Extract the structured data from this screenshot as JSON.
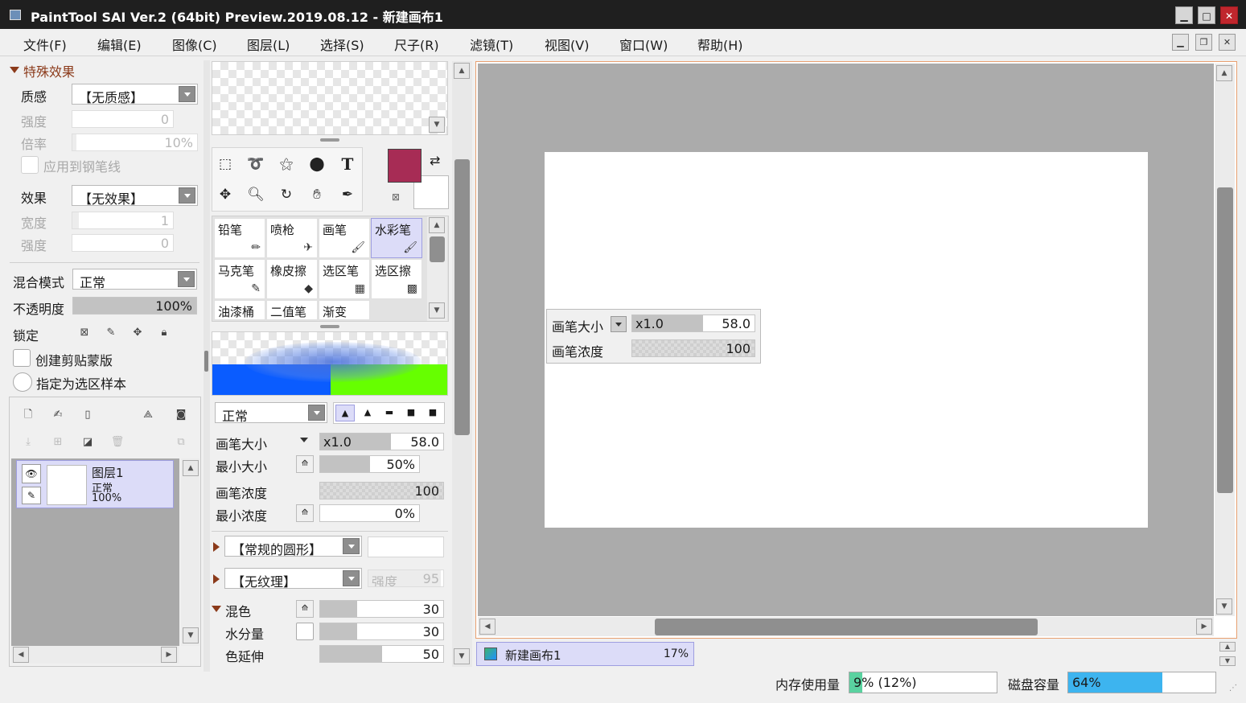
{
  "window": {
    "title": "PaintTool SAI Ver.2 (64bit) Preview.2019.08.12 - 新建画布1"
  },
  "menu": [
    "文件(F)",
    "编辑(E)",
    "图像(C)",
    "图层(L)",
    "选择(S)",
    "尺子(R)",
    "滤镜(T)",
    "视图(V)",
    "窗口(W)",
    "帮助(H)"
  ],
  "effects": {
    "section": "特殊效果",
    "texture_label": "质感",
    "texture_value": "【无质感】",
    "strength_label": "强度",
    "strength_value": "0",
    "rate_label": "倍率",
    "rate_value": "10%",
    "apply_pen_label": "应用到钢笔线",
    "effect_label": "效果",
    "effect_value": "【无效果】",
    "width_label": "宽度",
    "width_value": "1",
    "strength2_label": "强度",
    "strength2_value": "0"
  },
  "layerprops": {
    "blend_label": "混合模式",
    "blend_value": "正常",
    "opacity_label": "不透明度",
    "opacity_value": "100%",
    "opacity": 1.0,
    "lock_label": "锁定",
    "clip_label": "创建剪贴蒙版",
    "selsrc_label": "指定为选区样本"
  },
  "layers": [
    {
      "name": "图层1",
      "mode": "正常",
      "opacity": "100%"
    }
  ],
  "colors": {
    "primary": "#a72c55",
    "secondary": "#ffffff",
    "accent_blue": "#0a5cff",
    "accent_green": "#66ff00",
    "close_red": "#c0262d"
  },
  "brushes": [
    {
      "name": "铅笔",
      "icon": "pencil-icon"
    },
    {
      "name": "喷枪",
      "icon": "airbrush-icon"
    },
    {
      "name": "画笔",
      "icon": "brush-icon"
    },
    {
      "name": "水彩笔",
      "icon": "watercolor-icon",
      "selected": true
    },
    {
      "name": "马克笔",
      "icon": "marker-icon"
    },
    {
      "name": "橡皮擦",
      "icon": "eraser-icon"
    },
    {
      "name": "选区笔",
      "icon": "selpen-icon"
    },
    {
      "name": "选区擦",
      "icon": "selerase-icon"
    },
    {
      "name": "油漆桶",
      "icon": "bucket-icon"
    },
    {
      "name": "二值笔",
      "icon": "binary-pen-icon"
    },
    {
      "name": "渐变",
      "icon": "gradient-icon"
    }
  ],
  "brushsettings": {
    "mode_value": "正常",
    "size_label": "画笔大小",
    "size_mult": "x1.0",
    "size_value": "58.0",
    "minsize_label": "最小大小",
    "minsize_value": "50%",
    "minsize": 0.5,
    "density_label": "画笔浓度",
    "density_value": "100",
    "mindensity_label": "最小浓度",
    "mindensity_value": "0%",
    "shape_value": "【常规的圆形】",
    "texture_value": "【无纹理】",
    "texture_strength_label": "强度",
    "texture_strength_value": "95",
    "mix_label": "混色",
    "mix_value": "30",
    "mix": 0.3,
    "water_label": "水分量",
    "water_value": "30",
    "water": 0.3,
    "stretch_label": "色延伸",
    "stretch_value": "50",
    "stretch": 0.5
  },
  "canvas": {
    "tab_name": "新建画布1",
    "zoom": "17%"
  },
  "overlay": {
    "size_label": "画笔大小",
    "size_mult": "x1.0",
    "size_value": "58.0",
    "density_label": "画笔浓度",
    "density_value": "100"
  },
  "status": {
    "memory_label": "内存使用量",
    "memory_value": "9% (12%)",
    "memory": 0.09,
    "disk_label": "磁盘容量",
    "disk_value": "64%",
    "disk": 0.64
  }
}
